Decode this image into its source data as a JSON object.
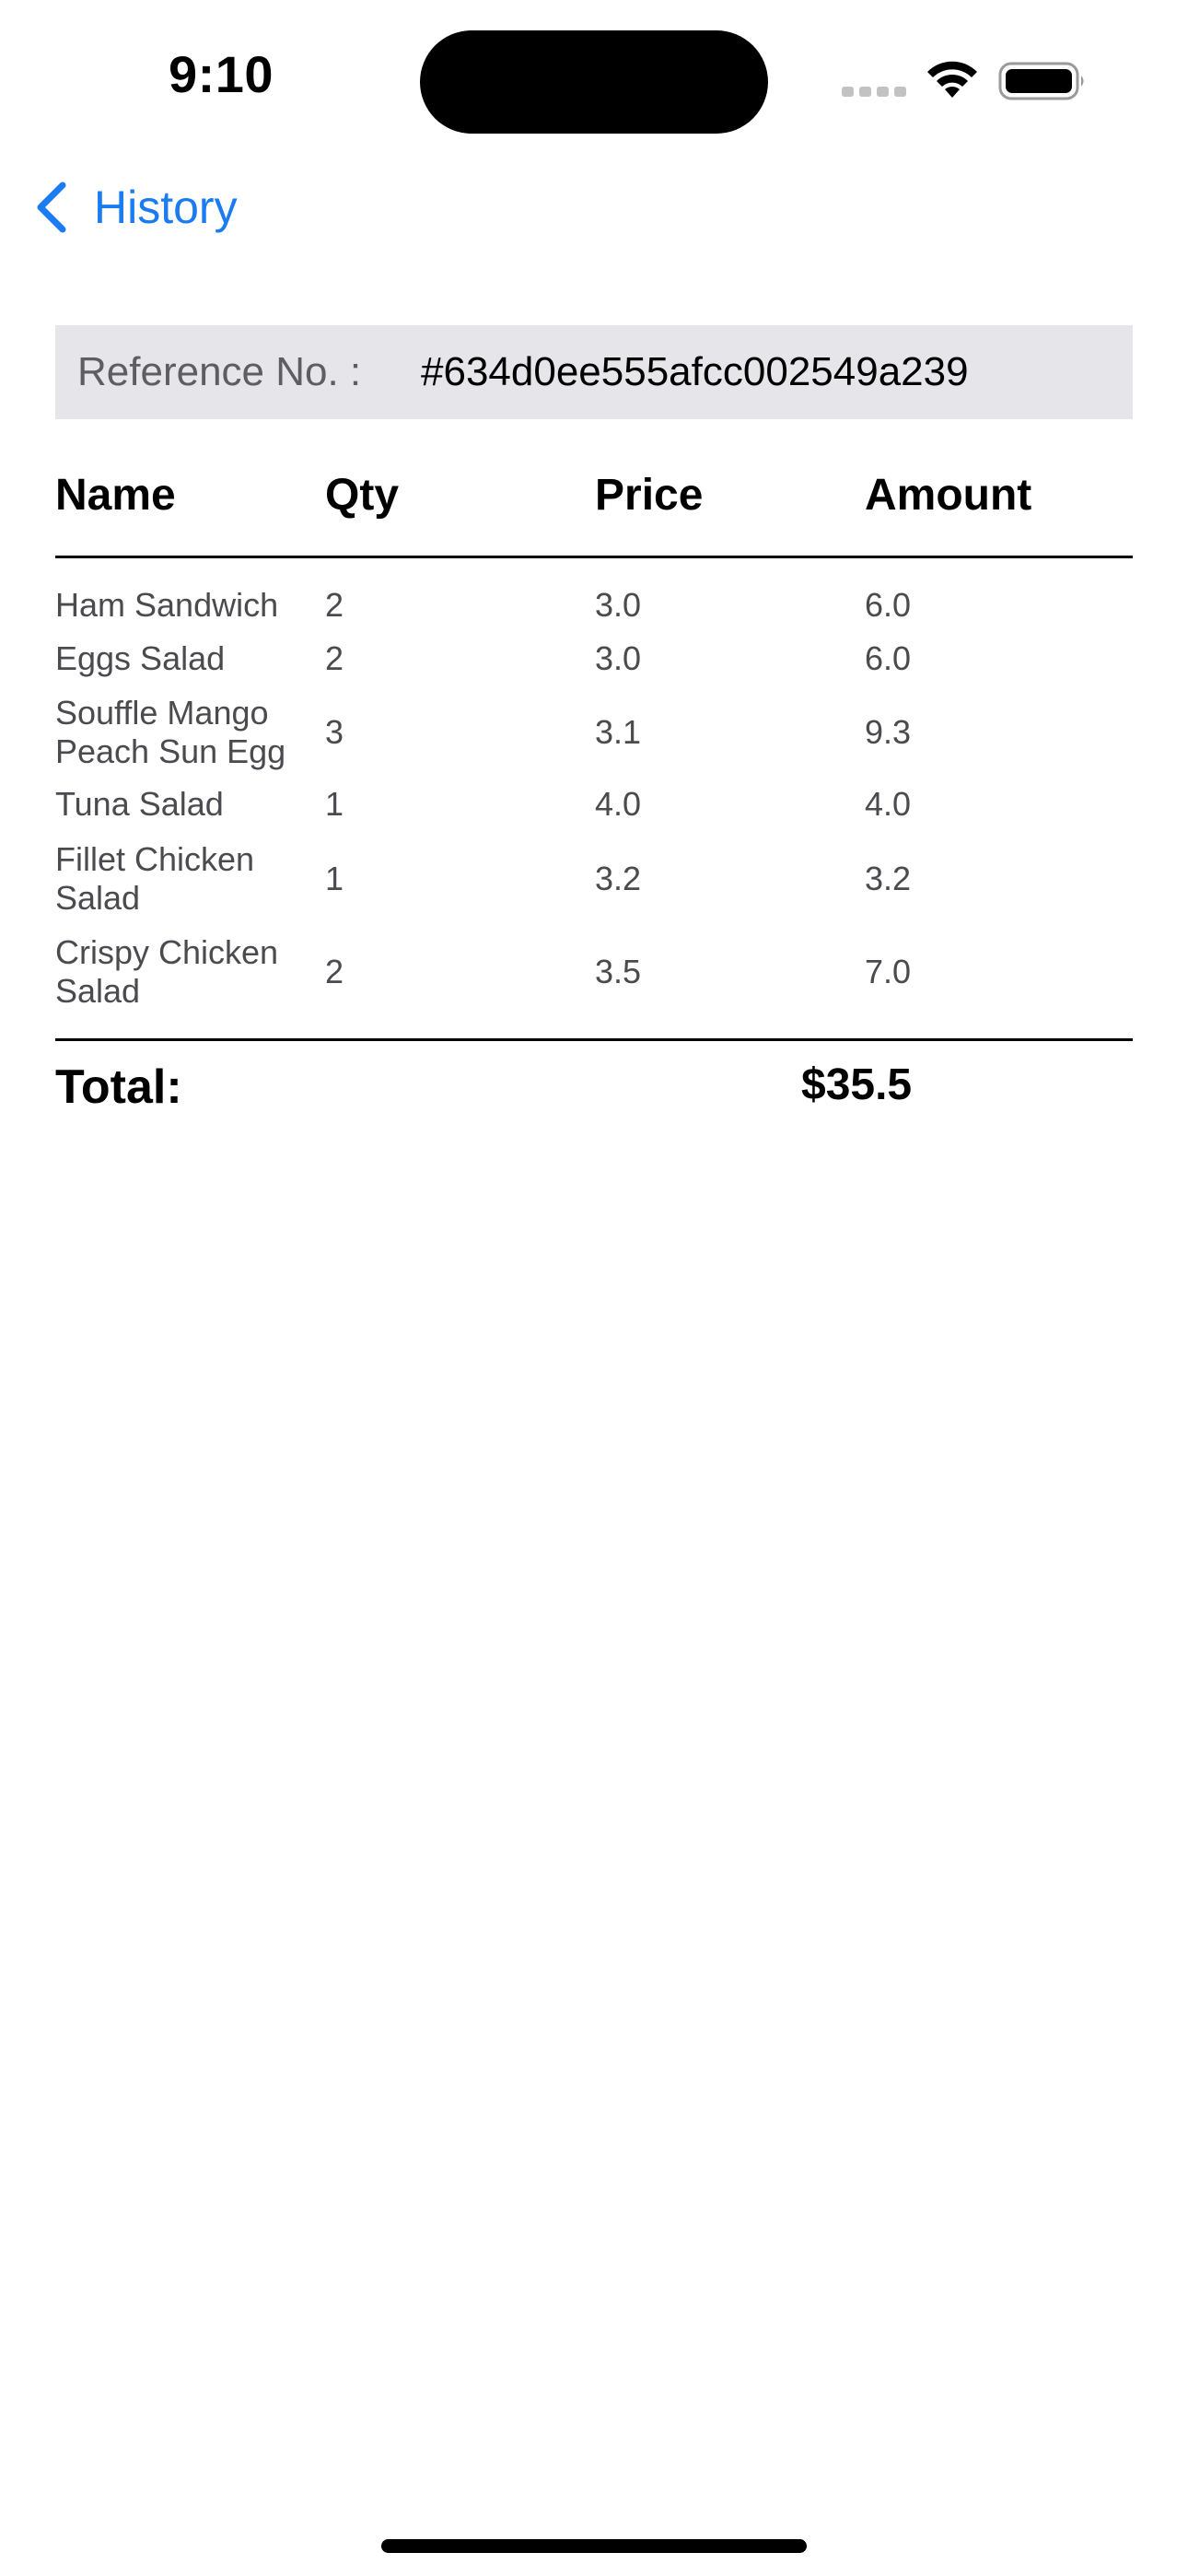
{
  "status_bar": {
    "time": "9:10"
  },
  "nav": {
    "back_label": "History",
    "accent_color": "#1a7cf0"
  },
  "reference": {
    "label": "Reference No. :",
    "value": "#634d0ee555afcc002549a239"
  },
  "table": {
    "headers": {
      "name": "Name",
      "qty": "Qty",
      "price": "Price",
      "amount": "Amount"
    },
    "rows": [
      {
        "name": "Ham Sandwich",
        "qty": "2",
        "price": "3.0",
        "amount": "6.0"
      },
      {
        "name": "Eggs Salad",
        "qty": "2",
        "price": "3.0",
        "amount": "6.0"
      },
      {
        "name": "Souffle Mango Peach Sun Egg",
        "qty": "3",
        "price": "3.1",
        "amount": "9.3"
      },
      {
        "name": "Tuna Salad",
        "qty": "1",
        "price": "4.0",
        "amount": "4.0"
      },
      {
        "name": "Fillet Chicken Salad",
        "qty": "1",
        "price": "3.2",
        "amount": "3.2"
      },
      {
        "name": "Crispy Chicken Salad",
        "qty": "2",
        "price": "3.5",
        "amount": "7.0"
      }
    ]
  },
  "total": {
    "label": "Total:",
    "value": "$35.5"
  }
}
